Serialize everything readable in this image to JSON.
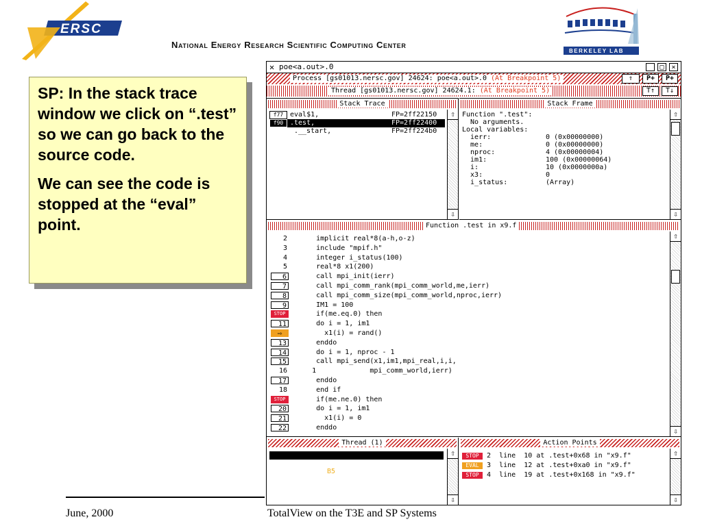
{
  "header": {
    "org_logo_text": "ERSC",
    "title": "National Energy Research Scientific Computing Center",
    "lab_logo_text": "Berkeley Lab"
  },
  "callout": {
    "para1": "SP: In the stack trace window we click on “.test” so we can go back to the source code.",
    "para2": "We can see the code is stopped at the “eval” point."
  },
  "window": {
    "title": "poe<a.out>.0",
    "process_line": {
      "text": "Process [gs01013.nersc.gov] 24624: poe<a.out>.0 ",
      "status": "(At Breakpoint 5)"
    },
    "thread_line": {
      "text": "Thread [gs01013.nersc.gov] 24624.1: ",
      "status": "(At Breakpoint 5)"
    },
    "stack_trace": {
      "header": "Stack Trace",
      "rows": [
        {
          "lang": "f77",
          "name": "eval$1,",
          "fp": "FP=2ff22150",
          "selected": false
        },
        {
          "lang": "f90",
          "name": ".test,",
          "fp": "FP=2ff22400",
          "selected": true
        },
        {
          "lang": "",
          "name": ".__start,",
          "fp": "FP=2ff224b0",
          "selected": false
        }
      ]
    },
    "stack_frame": {
      "header": "Stack Frame",
      "lines": [
        {
          "name": "Function \".test\":",
          "value": ""
        },
        {
          "name": "  No arguments.",
          "value": ""
        },
        {
          "name": "Local variables:",
          "value": ""
        },
        {
          "name": "  ierr:",
          "value": "0 (0x00000000)"
        },
        {
          "name": "  me:",
          "value": "0 (0x00000000)"
        },
        {
          "name": "  nproc:",
          "value": "4 (0x00000004)"
        },
        {
          "name": "  im1:",
          "value": "100 (0x00000064)"
        },
        {
          "name": "  i:",
          "value": "10 (0x0000000a)"
        },
        {
          "name": "  x3:",
          "value": "0"
        },
        {
          "name": "  i_status:",
          "value": "(Array)"
        }
      ]
    },
    "source": {
      "header": "Function .test in x9.f",
      "lines": [
        {
          "num": "2",
          "marker": "",
          "code": "      implicit real*8(a-h,o-z)"
        },
        {
          "num": "3",
          "marker": "",
          "code": "      include \"mpif.h\""
        },
        {
          "num": "4",
          "marker": "",
          "code": "      integer i_status(100)"
        },
        {
          "num": "5",
          "marker": "",
          "code": "      real*8 x1(200)"
        },
        {
          "num": "6",
          "marker": "box",
          "code": "      call mpi_init(ierr)"
        },
        {
          "num": "7",
          "marker": "box",
          "code": "      call mpi_comm_rank(mpi_comm_world,me,ierr)"
        },
        {
          "num": "8",
          "marker": "box",
          "code": "      call mpi_comm_size(mpi_comm_world,nproc,ierr)"
        },
        {
          "num": "9",
          "marker": "box",
          "code": "      IM1 = 100"
        },
        {
          "num": "STOP",
          "marker": "stop",
          "code": "      if(me.eq.0) then"
        },
        {
          "num": "11",
          "marker": "box",
          "code": "      do i = 1, im1"
        },
        {
          "num": "⇨",
          "marker": "pc",
          "code": "        x1(i) = rand()"
        },
        {
          "num": "13",
          "marker": "box",
          "code": "      enddo"
        },
        {
          "num": "14",
          "marker": "box",
          "code": "      do i = 1, nproc - 1"
        },
        {
          "num": "15",
          "marker": "box",
          "code": "      call mpi_send(x1,im1,mpi_real,i,i,"
        },
        {
          "num": "16",
          "marker": "",
          "code": "     1             mpi_comm_world,ierr)"
        },
        {
          "num": "17",
          "marker": "box",
          "code": "      enddo"
        },
        {
          "num": "18",
          "marker": "",
          "code": "      end if"
        },
        {
          "num": "STOP",
          "marker": "stop",
          "code": "      if(me.ne.0) then"
        },
        {
          "num": "20",
          "marker": "box",
          "code": "      do i = 1, im1"
        },
        {
          "num": "21",
          "marker": "box",
          "code": "        x1(i) = 0"
        },
        {
          "num": "22",
          "marker": "box",
          "code": "      enddo"
        }
      ]
    },
    "thread_pane": {
      "header": "Thread (1)",
      "row": {
        "id": "1/54695",
        "state": "B5",
        "where": "in eval$1"
      }
    },
    "action_points": {
      "header": "Action Points",
      "rows": [
        {
          "kind": "STOP",
          "text": " 2  line  10 at .test+0x68 in \"x9.f\""
        },
        {
          "kind": "EVAL",
          "text": " 3  line  12 at .test+0xa0 in \"x9.f\""
        },
        {
          "kind": "STOP",
          "text": " 4  line  19 at .test+0x168 in \"x9.f\""
        }
      ]
    }
  },
  "footer": {
    "date": "June, 2000",
    "title": "TotalView on the T3E and SP Systems"
  }
}
